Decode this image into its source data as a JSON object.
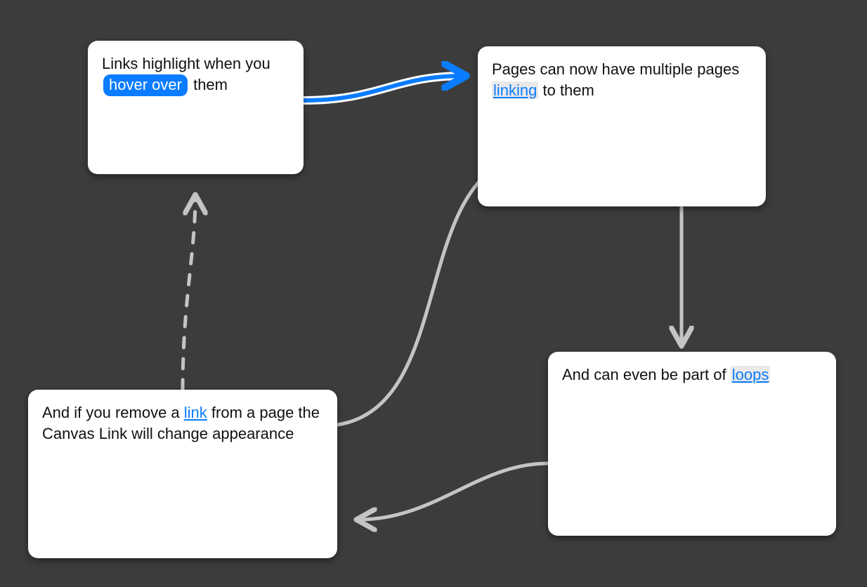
{
  "nodes": {
    "n1": {
      "text_before": "Links highlight when you",
      "pill": "hover over",
      "text_after": "them"
    },
    "n2": {
      "text_before": "Pages can now have multiple pages ",
      "link": "linking",
      "text_after": " to them"
    },
    "n3": {
      "text_before": "And if you remove a ",
      "link": "link",
      "text_after": " from a page the Canvas Link will change appearance"
    },
    "n4": {
      "text_before": "And can even be part of ",
      "link": "loops",
      "text_after": ""
    }
  },
  "edges": [
    {
      "from": "n1",
      "to": "n2",
      "style": "highlighted"
    },
    {
      "from": "n3",
      "to": "n2",
      "style": "solid"
    },
    {
      "from": "n2",
      "to": "n4",
      "style": "solid"
    },
    {
      "from": "n4",
      "to": "n3",
      "style": "solid"
    },
    {
      "from": "n3",
      "to": "n1",
      "style": "dashed"
    }
  ],
  "colors": {
    "bg": "#3c3c3c",
    "node_bg": "#ffffff",
    "wire_gray": "#c4c4c4",
    "wire_highlight": "#0a7cff",
    "link_blue": "#0a7cff",
    "link_bg": "#e9e9e9"
  }
}
